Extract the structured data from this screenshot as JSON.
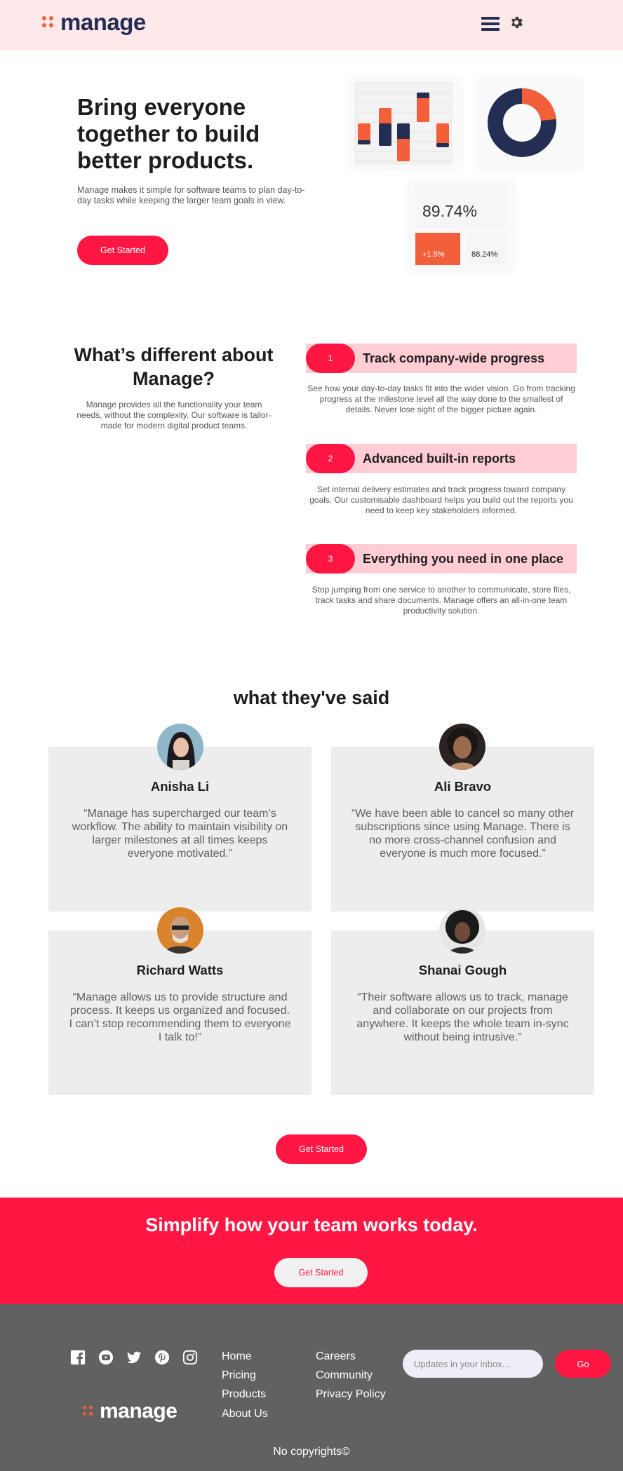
{
  "header": {
    "logo_text": "manage"
  },
  "hero": {
    "title": "Bring everyone together to build better products.",
    "description": "Manage makes it simple for software teams to plan day-to-day tasks while keeping the larger team goals in view.",
    "cta_label": "Get Started",
    "stat_main": "89.74%",
    "stat_change": "+1.5%",
    "stat_secondary": "88.24%",
    "donut_fraction": 0.27
  },
  "features": {
    "title": "What’s different about Manage?",
    "description": "Manage provides all the functionality your team needs, without the complexity. Our software is tailor-made for modern digital product teams.",
    "items": [
      {
        "number": "1",
        "title": "Track company-wide progress",
        "description": "See how your day-to-day tasks fit into the wider vision. Go from tracking progress at the milestone level all the way done to the smallest of details. Never lose sight of the bigger picture again."
      },
      {
        "number": "2",
        "title": "Advanced built-in reports",
        "description": "Set internal delivery estimates and track progress toward company goals. Our customisable dashboard helps you build out the reports you need to keep key stakeholders informed."
      },
      {
        "number": "3",
        "title": "Everything you need in one place",
        "description": "Stop jumping from one service to another to communicate, store files, track tasks and share documents. Manage offers an all-in-one team productivity solution."
      }
    ]
  },
  "testimonials": {
    "title": "what they've said",
    "items": [
      {
        "name": "Anisha Li",
        "quote": "“Manage has supercharged our team’s workflow. The ability to maintain visibility on larger milestones at all times keeps everyone motivated.”"
      },
      {
        "name": "Ali Bravo",
        "quote": "“We have been able to cancel so many other subscriptions since using Manage. There is no more cross-channel confusion and everyone is much more focused.”"
      },
      {
        "name": "Richard Watts",
        "quote": "“Manage allows us to provide structure and process. It keeps us organized and focused. I can’t stop recommending them to everyone I talk to!”"
      },
      {
        "name": "Shanai Gough",
        "quote": "“Their software allows us to track, manage and collaborate on our projects from anywhere. It keeps the whole team in-sync without being intrusive.”"
      }
    ],
    "cta_label": "Get Started"
  },
  "cta_banner": {
    "title": "Simplify how your team works today.",
    "button_label": "Get Started"
  },
  "footer": {
    "logo_text": "manage",
    "social_icons": [
      "facebook-icon",
      "youtube-icon",
      "twitter-icon",
      "pinterest-icon",
      "instagram-icon"
    ],
    "links_col1": [
      "Home",
      "Pricing",
      "Products",
      "About Us"
    ],
    "links_col2": [
      "Careers",
      "Community",
      "Privacy Policy"
    ],
    "newsletter_placeholder": "Updates in your inbox...",
    "go_label": "Go",
    "copyright": "No copyrights©"
  },
  "colors": {
    "brand_red": "#ff1744",
    "brand_orange": "#f25f3a",
    "brand_navy": "#242d52",
    "header_bg": "#ffe8ea",
    "footer_bg": "#616161"
  }
}
